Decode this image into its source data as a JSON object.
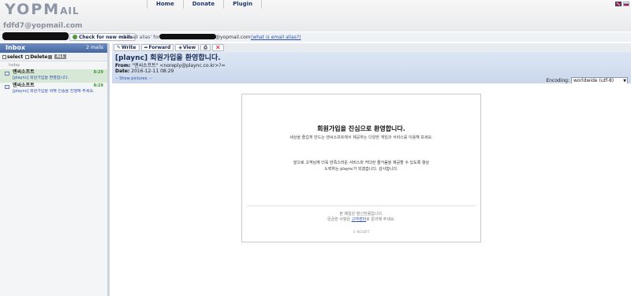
{
  "header": {
    "logo_main": "YOPM",
    "logo_tail": "AIL",
    "account_email": "fdfd7@yopmail.com",
    "nav": [
      {
        "label": "Home"
      },
      {
        "label": "Donate"
      },
      {
        "label": "Plugin"
      }
    ]
  },
  "account_bar": {
    "refresh_label": "Check for new mails",
    "alias_label": "E-mail alias' for",
    "alias_domain": "@yopmail.com",
    "alias_help_link": "(what is email alias?)"
  },
  "inbox": {
    "title": "Inbox",
    "count": "2 mails",
    "tools": {
      "select_label": "select",
      "delete_label": "Delete",
      "all_label": "ALL"
    },
    "day_label": "today",
    "messages": [
      {
        "from": "엔씨소프트",
        "subject": "[plaync] 회원가입을 환영합니다.",
        "time": "8:29"
      },
      {
        "from": "엔씨소프트",
        "subject": "[plaync] 회원가입을 위해 인증을 진행해 주세요.",
        "time": "8:29"
      }
    ]
  },
  "reader": {
    "toolbar": {
      "write_label": "Write",
      "forward_label": "Forward",
      "view_label": "View",
      "print_icon": "print-icon",
      "delete_icon": "delete-x-icon"
    },
    "subject": "[plaync] 회원가입을 환영합니다.",
    "from_label": "From:",
    "from_value": "\"엔씨소프트\" <noreply@plaync.co.kr>?=",
    "date_label": "Date:",
    "date_value": "2016-12-11 08:29",
    "show_pictures": "-- Show pictures. --",
    "encoding_label": "Encoding:",
    "encoding_value": "worldwide (utf-8)"
  },
  "email_body": {
    "title": "회원가입을 진심으로 환영합니다.",
    "subtitle": "세상을 즐겁게 만드는 엔씨소프트에서 제공하는 다양한 게임과 서비스를 이용해 보세요.",
    "para_line1": "앞으로 고객님께 더욱 만족스러운 서비스와 커다란 즐거움을 제공할 수 있도록 항상",
    "para_line2": "노력하는 plaync가 되겠습니다. 감사합니다.",
    "footer_line1": "본 메일은 발신전용입니다.",
    "footer_line2_pre": "궁금한 사항은 ",
    "footer_link": "고객센터",
    "footer_line2_post": "로 문의해 주세요.",
    "copyright": "© NCSOFT"
  },
  "colors": {
    "inbox_header": "#45679f",
    "mail_header": "#cbd8ec",
    "link": "#2b50b0",
    "time_green": "#3a9a33"
  }
}
